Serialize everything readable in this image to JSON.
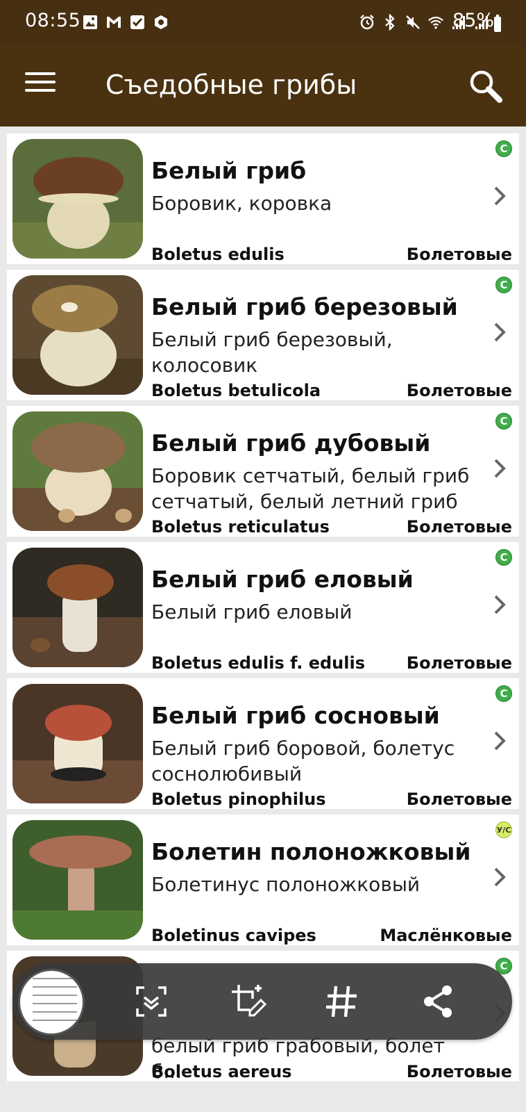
{
  "status": {
    "time": "08:55",
    "battery": "85%"
  },
  "appbar": {
    "title": "Съедобные грибы",
    "menu_icon": "hamburger-menu-icon",
    "search_icon": "search-icon"
  },
  "mushrooms": [
    {
      "name": "Белый гриб",
      "synonyms": "Боровик, коровка",
      "latin": "Boletus edulis",
      "family": "Болетовые",
      "badge": "С",
      "badge_color": "#3fae4a"
    },
    {
      "name": "Белый гриб березовый",
      "synonyms": "Белый гриб березовый, колосовик",
      "latin": "Boletus betulicola",
      "family": "Болетовые",
      "badge": "С",
      "badge_color": "#3fae4a"
    },
    {
      "name": "Белый гриб дубовый",
      "synonyms": "Боровик сетчатый, белый гриб сетчатый, белый летний гриб",
      "latin": "Boletus reticulatus",
      "family": "Болетовые",
      "badge": "С",
      "badge_color": "#3fae4a"
    },
    {
      "name": "Белый гриб еловый",
      "synonyms": "Белый гриб еловый",
      "latin": "Boletus edulis f. edulis",
      "family": "Болетовые",
      "badge": "С",
      "badge_color": "#3fae4a"
    },
    {
      "name": "Белый гриб сосновый",
      "synonyms": "Белый гриб боровой, болетус соснолюбивый",
      "latin": "Boletus pinophilus",
      "family": "Болетовые",
      "badge": "С",
      "badge_color": "#3fae4a"
    },
    {
      "name": "Болетин полоножковый",
      "synonyms": "Болетинус полоножковый",
      "latin": "Boletinus cavipes",
      "family": "Маслёнковые",
      "badge": "У/С",
      "badge_color": "#d6ee63"
    },
    {
      "name": "",
      "synonyms": "белый гриб грабовый, болет б...",
      "latin": "Boletus aereus",
      "family": "Болетовые",
      "badge": "С",
      "badge_color": "#3fae4a"
    }
  ],
  "screenshot_toolbar": {
    "icons": [
      "screenshot-preview-thumbnail",
      "scroll-capture-icon",
      "crop-edit-icon",
      "hashtag-icon",
      "share-icon"
    ]
  },
  "colors": {
    "appbar": "#4a3211",
    "statusbar": "#472f12",
    "edible_badge": "#3fae4a",
    "conditional_badge": "#d6ee63"
  }
}
